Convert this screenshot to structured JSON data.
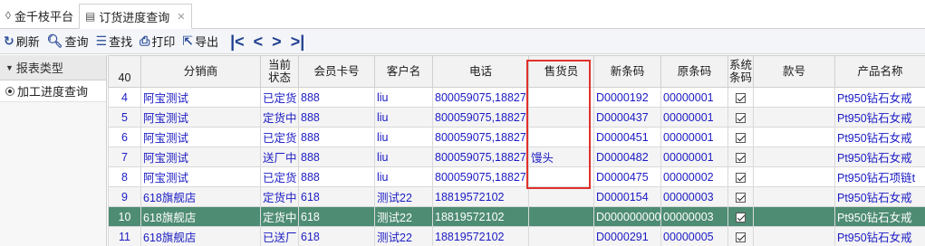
{
  "tabs": [
    {
      "label": "金千枝平台",
      "icon": "logo-icon"
    },
    {
      "label": "订货进度查询",
      "icon": "document-icon",
      "active": true
    }
  ],
  "toolbar": {
    "refresh": "刷新",
    "query": "查询",
    "find": "查找",
    "print": "打印",
    "export": "导出"
  },
  "sidebar": {
    "header": "报表类型",
    "items": [
      {
        "label": "加工进度查询",
        "selected": true
      }
    ]
  },
  "grid": {
    "row_count": "40",
    "columns": [
      "分销商",
      "当前\n状态",
      "会员卡号",
      "客户名",
      "电话",
      "售货员",
      "新条码",
      "原条码",
      "系统\n条码",
      "款号",
      "产品名称"
    ],
    "rows": [
      {
        "n": "4",
        "dist": "阿宝测试",
        "status": "已定货",
        "card": "888",
        "cust": "liu",
        "phone": "800059075,18827",
        "seller": "",
        "newbc": "D0000192",
        "oldbc": "00000001",
        "sys": true,
        "style": "",
        "product": "Pt950钻石女戒"
      },
      {
        "n": "5",
        "dist": "阿宝测试",
        "status": "定货中",
        "card": "888",
        "cust": "liu",
        "phone": "800059075,18827",
        "seller": "",
        "newbc": "D0000437",
        "oldbc": "00000001",
        "sys": true,
        "style": "",
        "product": "Pt950钻石女戒"
      },
      {
        "n": "6",
        "dist": "阿宝测试",
        "status": "已定货",
        "card": "888",
        "cust": "liu",
        "phone": "800059075,18827",
        "seller": "",
        "newbc": "D0000451",
        "oldbc": "00000001",
        "sys": true,
        "style": "",
        "product": "Pt950钻石女戒"
      },
      {
        "n": "7",
        "dist": "阿宝测试",
        "status": "送厂中",
        "card": "888",
        "cust": "liu",
        "phone": "800059075,18827",
        "seller": "馒头",
        "newbc": "D0000482",
        "oldbc": "00000001",
        "sys": true,
        "style": "",
        "product": "Pt950钻石女戒"
      },
      {
        "n": "8",
        "dist": "阿宝测试",
        "status": "已定货",
        "card": "888",
        "cust": "liu",
        "phone": "800059075,18827",
        "seller": "",
        "newbc": "D0000475",
        "oldbc": "00000002",
        "sys": true,
        "style": "",
        "product": "Pt950钻石项链t"
      },
      {
        "n": "9",
        "dist": "618旗舰店",
        "status": "定货中",
        "card": "618",
        "cust": "测试22",
        "phone": "18819572102",
        "seller": "",
        "newbc": "D0000154",
        "oldbc": "00000003",
        "sys": true,
        "style": "",
        "product": "Pt950钻石女戒"
      },
      {
        "n": "10",
        "dist": "618旗舰店",
        "status": "定货中",
        "card": "618",
        "cust": "测试22",
        "phone": "18819572102",
        "seller": "",
        "newbc": "D0000000000",
        "oldbc": "00000003",
        "sys": true,
        "style": "",
        "product": "Pt950钻石女戒"
      },
      {
        "n": "11",
        "dist": "618旗舰店",
        "status": "已送厂",
        "card": "618",
        "cust": "测试22",
        "phone": "18819572102",
        "seller": "",
        "newbc": "D0000291",
        "oldbc": "00000005",
        "sys": true,
        "style": "",
        "product": "Pt950钻石女戒"
      }
    ]
  }
}
